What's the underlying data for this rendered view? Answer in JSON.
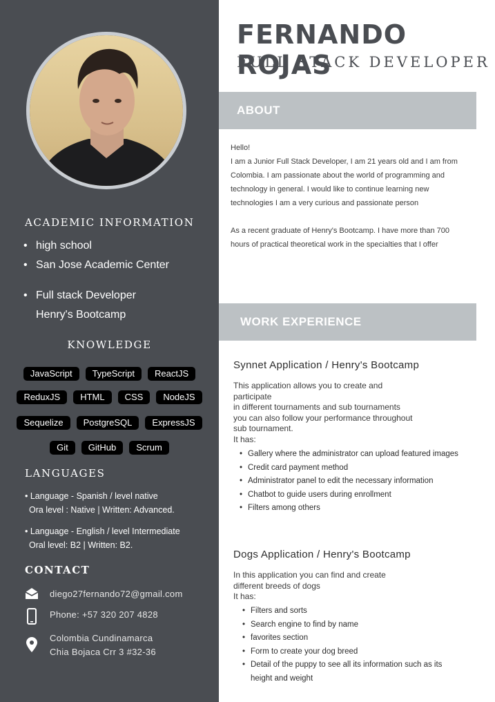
{
  "profile": {
    "name": "FERNANDO ROJAS",
    "role": "FULL STACK DEVELOPER"
  },
  "academic": {
    "heading": "ACADEMIC INFORMATION",
    "items": [
      "high school",
      "San Jose Academic Center",
      "Full stack Developer",
      "Henry's Bootcamp"
    ]
  },
  "knowledge": {
    "heading": "KNOWLEDGE",
    "rows": [
      [
        "JavaScript",
        "TypeScript",
        "ReactJS"
      ],
      [
        "ReduxJS",
        "HTML",
        "CSS",
        "NodeJS"
      ],
      [
        "Sequelize",
        "PostgreSQL",
        "ExpressJS"
      ],
      [
        "Git",
        "GitHub",
        "Scrum"
      ]
    ]
  },
  "languages": {
    "heading": "LANGUAGES",
    "items": [
      {
        "line1": "• Language - Spanish / level native",
        "line2": "Ora level : Native |  Written: Advanced."
      },
      {
        "line1": "• Language - English / level Intermediate",
        "line2": "Oral level: B2 | Written: B2."
      }
    ]
  },
  "contact": {
    "heading": "CONTACT",
    "email": "diego27fernando72@gmail.com",
    "phone": "Phone: +57 320 207 4828",
    "address_line1": "Colombia Cundinamarca",
    "address_line2": "Chia Bojaca Crr 3 #32-36",
    "icons": [
      "mail-icon",
      "phone-icon",
      "location-pin-icon"
    ]
  },
  "about": {
    "heading": "ABOUT",
    "greeting": "Hello!",
    "paragraph1": "I am a Junior Full Stack Developer, I am 21 years old and I am from Colombia. I am passionate about the world of programming and technology in general. I would like to continue learning new technologies I am a very curious and passionate person",
    "paragraph2": "As a recent graduate of Henry's Bootcamp. I have more than 700 hours of practical theoretical work in the specialties that I offer"
  },
  "work": {
    "heading": "WORK EXPERIENCE",
    "projects": [
      {
        "title": "Synnet Application / Henry's Bootcamp",
        "desc_lines": [
          "This application allows you to create and",
          "participate",
          "in different tournaments and sub tournaments",
          "you can also follow your performance throughout",
          "sub tournament.",
          "It has:"
        ],
        "features": [
          "Gallery where the administrator can upload featured images",
          "Credit card payment method",
          "Administrator panel to edit the necessary information",
          "Chatbot to guide users during enrollment",
          "Filters among others"
        ]
      },
      {
        "title": "Dogs Application / Henry's Bootcamp",
        "desc_lines": [
          "In this application you can find and create",
          "different breeds of dogs",
          "It has:"
        ],
        "features": [
          "Filters and sorts",
          "Search engine to find by name",
          "favorites section",
          "Form to create your dog breed",
          "Detail of the puppy to see all its information such as its height and weight"
        ]
      }
    ]
  },
  "colors": {
    "sidebar": "#4a4d52",
    "section_bar": "#bcc1c4",
    "chip": "#000000"
  }
}
